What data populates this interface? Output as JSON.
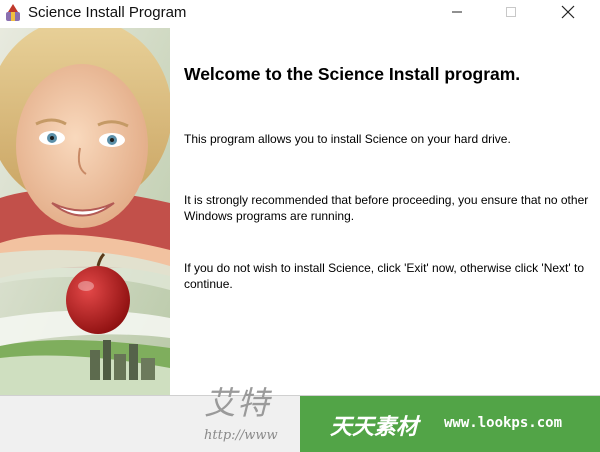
{
  "window": {
    "title": "Science Install Program",
    "minimize_glyph": "—",
    "maximize_glyph": "☐",
    "close_glyph": "✕"
  },
  "welcome": {
    "title": "Welcome to the Science Install program.",
    "paragraphs": [
      "This program allows you to install Science on your hard drive.",
      "It is strongly recommended that before proceeding, you ensure that no other Windows programs are running.",
      "If you do not wish to install Science, click 'Exit' now, otherwise click 'Next' to continue."
    ]
  },
  "watermarks": {
    "left_cn": "艾特",
    "left_url": "http://www",
    "badge_cn": "天天素材",
    "badge_url": "www.lookps.com"
  },
  "colors": {
    "badge_green": "#52a447",
    "panel_bg": "#cfd9c6",
    "apple_red": "#b01e1e"
  },
  "icons": {
    "app": "installer-icon",
    "minimize": "minimize-icon",
    "maximize": "maximize-icon",
    "close": "close-icon"
  }
}
